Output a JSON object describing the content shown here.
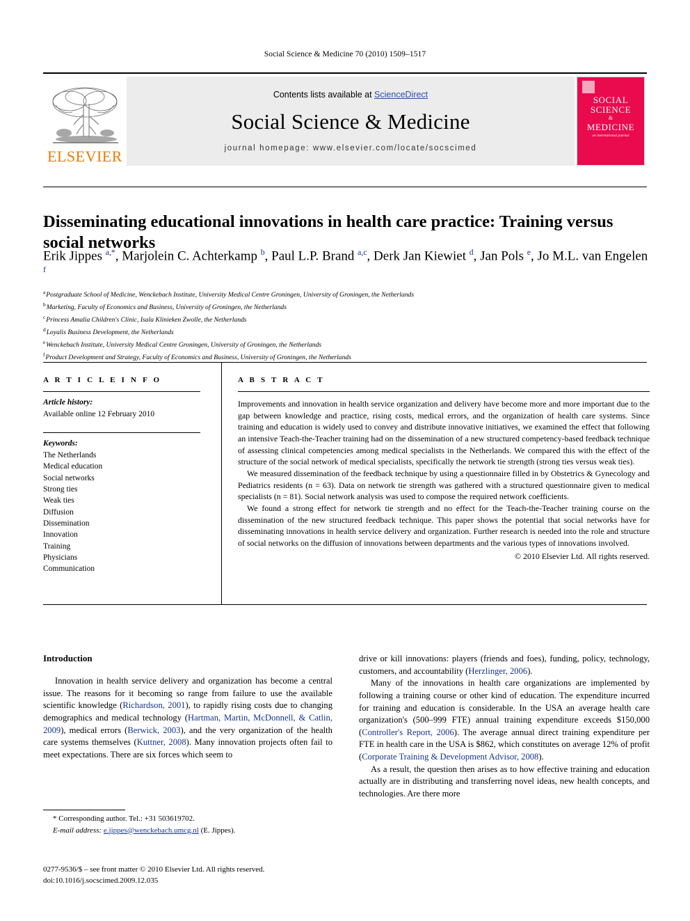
{
  "running_head": "Social Science & Medicine 70 (2010) 1509–1517",
  "masthead": {
    "publisher_word": "ELSEVIER",
    "publisher_logo_name": "elsevier-tree-logo",
    "contents_prefix": "Contents lists available at ",
    "contents_link": "ScienceDirect",
    "journal_title": "Social Science & Medicine",
    "homepage_line": "journal homepage: www.elsevier.com/locate/socscimed",
    "cover": {
      "line1": "SOCIAL",
      "line2": "SCIENCE",
      "amp": "&",
      "line4": "MEDICINE",
      "line5": "an international journal",
      "color": "#ea0a4e"
    }
  },
  "article": {
    "title": "Disseminating educational innovations in health care practice: Training versus social networks",
    "authors_html": "Erik Jippes <sup>a,*</sup>, Marjolein C. Achterkamp <sup>b</sup>, Paul L.P. Brand <sup>a,c</sup>, Derk Jan Kiewiet <sup>d</sup>, Jan Pols <sup>e</sup>, Jo M.L. van Engelen <sup>f</sup>",
    "authors_plain": "Erik Jippes a,*, Marjolein C. Achterkamp b, Paul L.P. Brand a,c, Derk Jan Kiewiet d, Jan Pols e, Jo M.L. van Engelen f",
    "affiliations": [
      {
        "mark": "a",
        "text": "Postgraduate School of Medicine, Wenckebach Institute, University Medical Centre Groningen, University of Groningen, the Netherlands"
      },
      {
        "mark": "b",
        "text": "Marketing, Faculty of Economics and Business, University of Groningen, the Netherlands"
      },
      {
        "mark": "c",
        "text": "Princess Amalia Children's Clinic, Isala Klinieken Zwolle, the Netherlands"
      },
      {
        "mark": "d",
        "text": "Loyalis Business Development, the Netherlands"
      },
      {
        "mark": "e",
        "text": "Wenckebach Institute, University Medical Centre Groningen, University of Groningen, the Netherlands"
      },
      {
        "mark": "f",
        "text": "Product Development and Strategy, Faculty of Economics and Business, University of Groningen, the Netherlands"
      }
    ]
  },
  "article_info": {
    "heading": "A R T I C L E  I N F O",
    "history_label": "Article history:",
    "history_value": "Available online 12 February 2010",
    "keywords_label": "Keywords:",
    "keywords": [
      "The Netherlands",
      "Medical education",
      "Social networks",
      "Strong ties",
      "Weak ties",
      "Diffusion",
      "Dissemination",
      "Innovation",
      "Training",
      "Physicians",
      "Communication"
    ]
  },
  "abstract": {
    "heading": "A B S T R A C T",
    "paragraphs": [
      "Improvements and innovation in health service organization and delivery have become more and more important due to the gap between knowledge and practice, rising costs, medical errors, and the organization of health care systems. Since training and education is widely used to convey and distribute innovative initiatives, we examined the effect that following an intensive Teach-the-Teacher training had on the dissemination of a new structured competency-based feedback technique of assessing clinical competencies among medical specialists in the Netherlands. We compared this with the effect of the structure of the social network of medical specialists, specifically the network tie strength (strong ties versus weak ties).",
      "We measured dissemination of the feedback technique by using a questionnaire filled in by Obstetrics & Gynecology and Pediatrics residents (n = 63). Data on network tie strength was gathered with a structured questionnaire given to medical specialists (n = 81). Social network analysis was used to compose the required network coefficients.",
      "We found a strong effect for network tie strength and no effect for the Teach-the-Teacher training course on the dissemination of the new structured feedback technique. This paper shows the potential that social networks have for disseminating innovations in health service delivery and organization. Further research is needed into the role and structure of social networks on the diffusion of innovations between departments and the various types of innovations involved."
    ],
    "copyright": "© 2010 Elsevier Ltd. All rights reserved."
  },
  "body": {
    "section_heading": "Introduction",
    "left_column": [
      {
        "runs": [
          {
            "t": "Innovation in health service delivery and organization has become a central issue. The reasons for it becoming so range from failure to use the available scientific knowledge (",
            "c": false
          },
          {
            "t": "Richardson, 2001",
            "c": true
          },
          {
            "t": "), to rapidly rising costs due to changing demographics and medical technology (",
            "c": false
          },
          {
            "t": "Hartman, Martin, McDonnell, & Catlin, 2009",
            "c": true
          },
          {
            "t": "), medical errors (",
            "c": false
          },
          {
            "t": "Berwick, 2003",
            "c": true
          },
          {
            "t": "), and the very organization of the health care systems themselves (",
            "c": false
          },
          {
            "t": "Kuttner, 2008",
            "c": true
          },
          {
            "t": "). Many innovation projects often fail to meet expectations. There are six forces which seem to",
            "c": false
          }
        ]
      }
    ],
    "right_column": [
      {
        "runs": [
          {
            "t": "drive or kill innovations: players (friends and foes), funding, policy, technology, customers, and accountability (",
            "c": false
          },
          {
            "t": "Herzlinger, 2006",
            "c": true
          },
          {
            "t": ").",
            "c": false
          }
        ],
        "indent": false
      },
      {
        "runs": [
          {
            "t": "Many of the innovations in health care organizations are implemented by following a training course or other kind of education. The expenditure incurred for training and education is considerable. In the USA an average health care organization's (500–999 FTE) annual training expenditure exceeds $150,000 (",
            "c": false
          },
          {
            "t": "Controller's Report, 2006",
            "c": true
          },
          {
            "t": "). The average annual direct training expenditure per FTE in health care in the USA is $862, which constitutes on average 12% of profit (",
            "c": false
          },
          {
            "t": "Corporate Training & Development Advisor, 2008",
            "c": true
          },
          {
            "t": ").",
            "c": false
          }
        ],
        "indent": true
      },
      {
        "runs": [
          {
            "t": "As a result, the question then arises as to how effective training and education actually are in distributing and transferring novel ideas, new health concepts, and technologies. Are there more",
            "c": false
          }
        ],
        "indent": true
      }
    ]
  },
  "footnotes": {
    "corresponding_author": "* Corresponding author. Tel.: +31 503619702.",
    "email_label": "E-mail address:",
    "email": "e.jippes@wenckebach.umcg.nl",
    "email_suffix": "(E. Jippes)."
  },
  "colophon": {
    "line1": "0277-9536/$ – see front matter © 2010 Elsevier Ltd. All rights reserved.",
    "line2": "doi:10.1016/j.socscimed.2009.12.035"
  },
  "colors": {
    "link": "#13348e",
    "sciencedirect": "#2b4ea2",
    "elsevier_orange": "#E87B00",
    "cover_red": "#ea0a4e",
    "band_grey": "#ececec"
  }
}
